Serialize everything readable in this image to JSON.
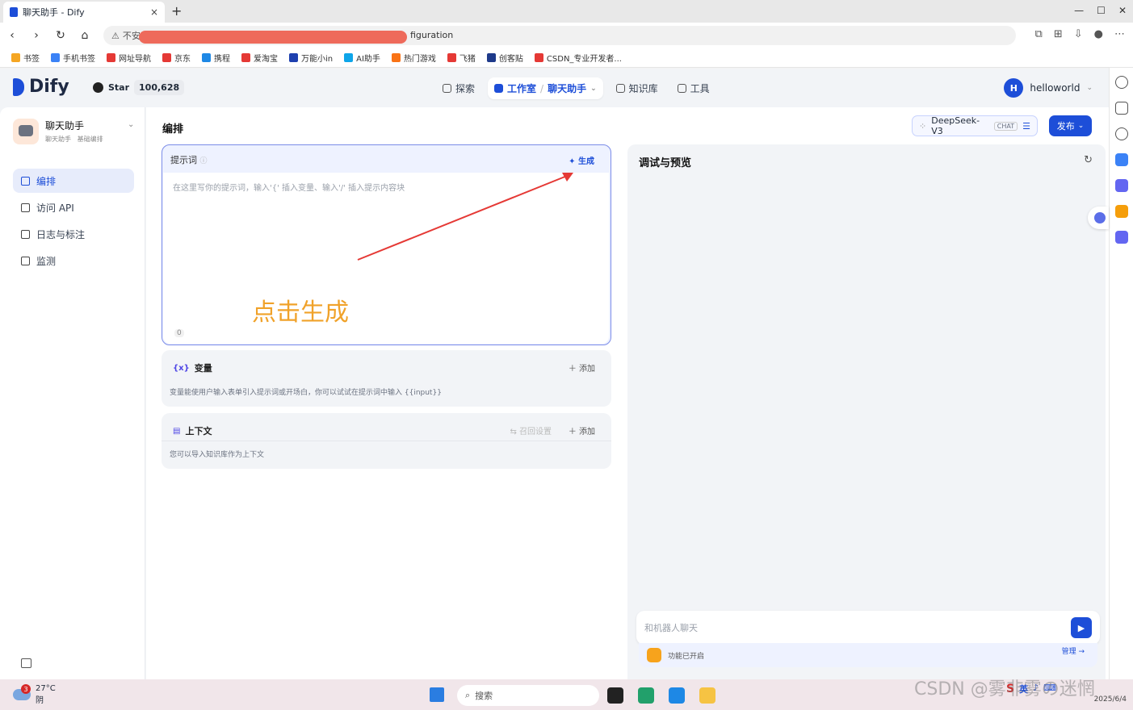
{
  "browser": {
    "tab_title": "聊天助手 - Dify",
    "tab_close": "×",
    "new_tab": "+",
    "url_prefix": "不安",
    "url_visible": "figuration",
    "bookmarks": [
      "书签",
      "手机书签",
      "网址导航",
      "京东",
      "携程",
      "爱淘宝",
      "万能小in",
      "AI助手",
      "热门游戏",
      "飞猪",
      "创客贴",
      "CSDN_专业开发者..."
    ],
    "bookmark_colors": [
      "#f5a623",
      "#3b82f6",
      "#e53935",
      "#e53935",
      "#1e88e5",
      "#e53935",
      "#1e40af",
      "#0ea5e9",
      "#f97316",
      "#e53935",
      "#1e3a8a",
      "#e53935"
    ]
  },
  "header": {
    "logo": "Dify",
    "github_star": "Star",
    "github_count": "100,628",
    "nav": {
      "explore": "探索",
      "studio": "工作室",
      "separator": "/",
      "current_app": "聊天助手",
      "knowledge": "知识库",
      "tools": "工具"
    },
    "user_initial": "H",
    "user_name": "helloworld"
  },
  "sidebar": {
    "app_name": "聊天助手",
    "app_type": "聊天助手",
    "app_mode": "基础编排",
    "items": [
      {
        "label": "编排",
        "active": true
      },
      {
        "label": "访问 API",
        "active": false
      },
      {
        "label": "日志与标注",
        "active": false
      },
      {
        "label": "监测",
        "active": false
      }
    ]
  },
  "main": {
    "title": "编排",
    "model": "DeepSeek-V3",
    "model_tag": "CHAT",
    "publish": "发布",
    "prompt": {
      "label": "提示词",
      "generate": "生成",
      "placeholder": "在这里写你的提示词，输入'{' 插入变量、输入'/' 插入提示内容块",
      "count": "0"
    },
    "annotation": "点击生成",
    "variables": {
      "icon": "{x}",
      "label": "变量",
      "add": "添加",
      "desc": "变量能使用户输入表单引入提示词或开场白，你可以试试在提示词中输入 {{input}}"
    },
    "context": {
      "label": "上下文",
      "recall": "召回设置",
      "add": "添加",
      "desc": "您可以导入知识库作为上下文"
    }
  },
  "debug": {
    "title": "调试与预览",
    "chat_placeholder": "和机器人聊天",
    "features": "功能已开启",
    "manage": "管理"
  },
  "taskbar": {
    "weather_badge": "3",
    "temperature": "27°C",
    "condition": "阴",
    "search": "搜索",
    "ime": "英",
    "date": "2025/6/4"
  },
  "watermark": "CSDN @雾非雾の迷惘",
  "colors": {
    "accent": "#1d4ed8",
    "annotation": "#f0a22a",
    "arrow": "#e53935"
  }
}
